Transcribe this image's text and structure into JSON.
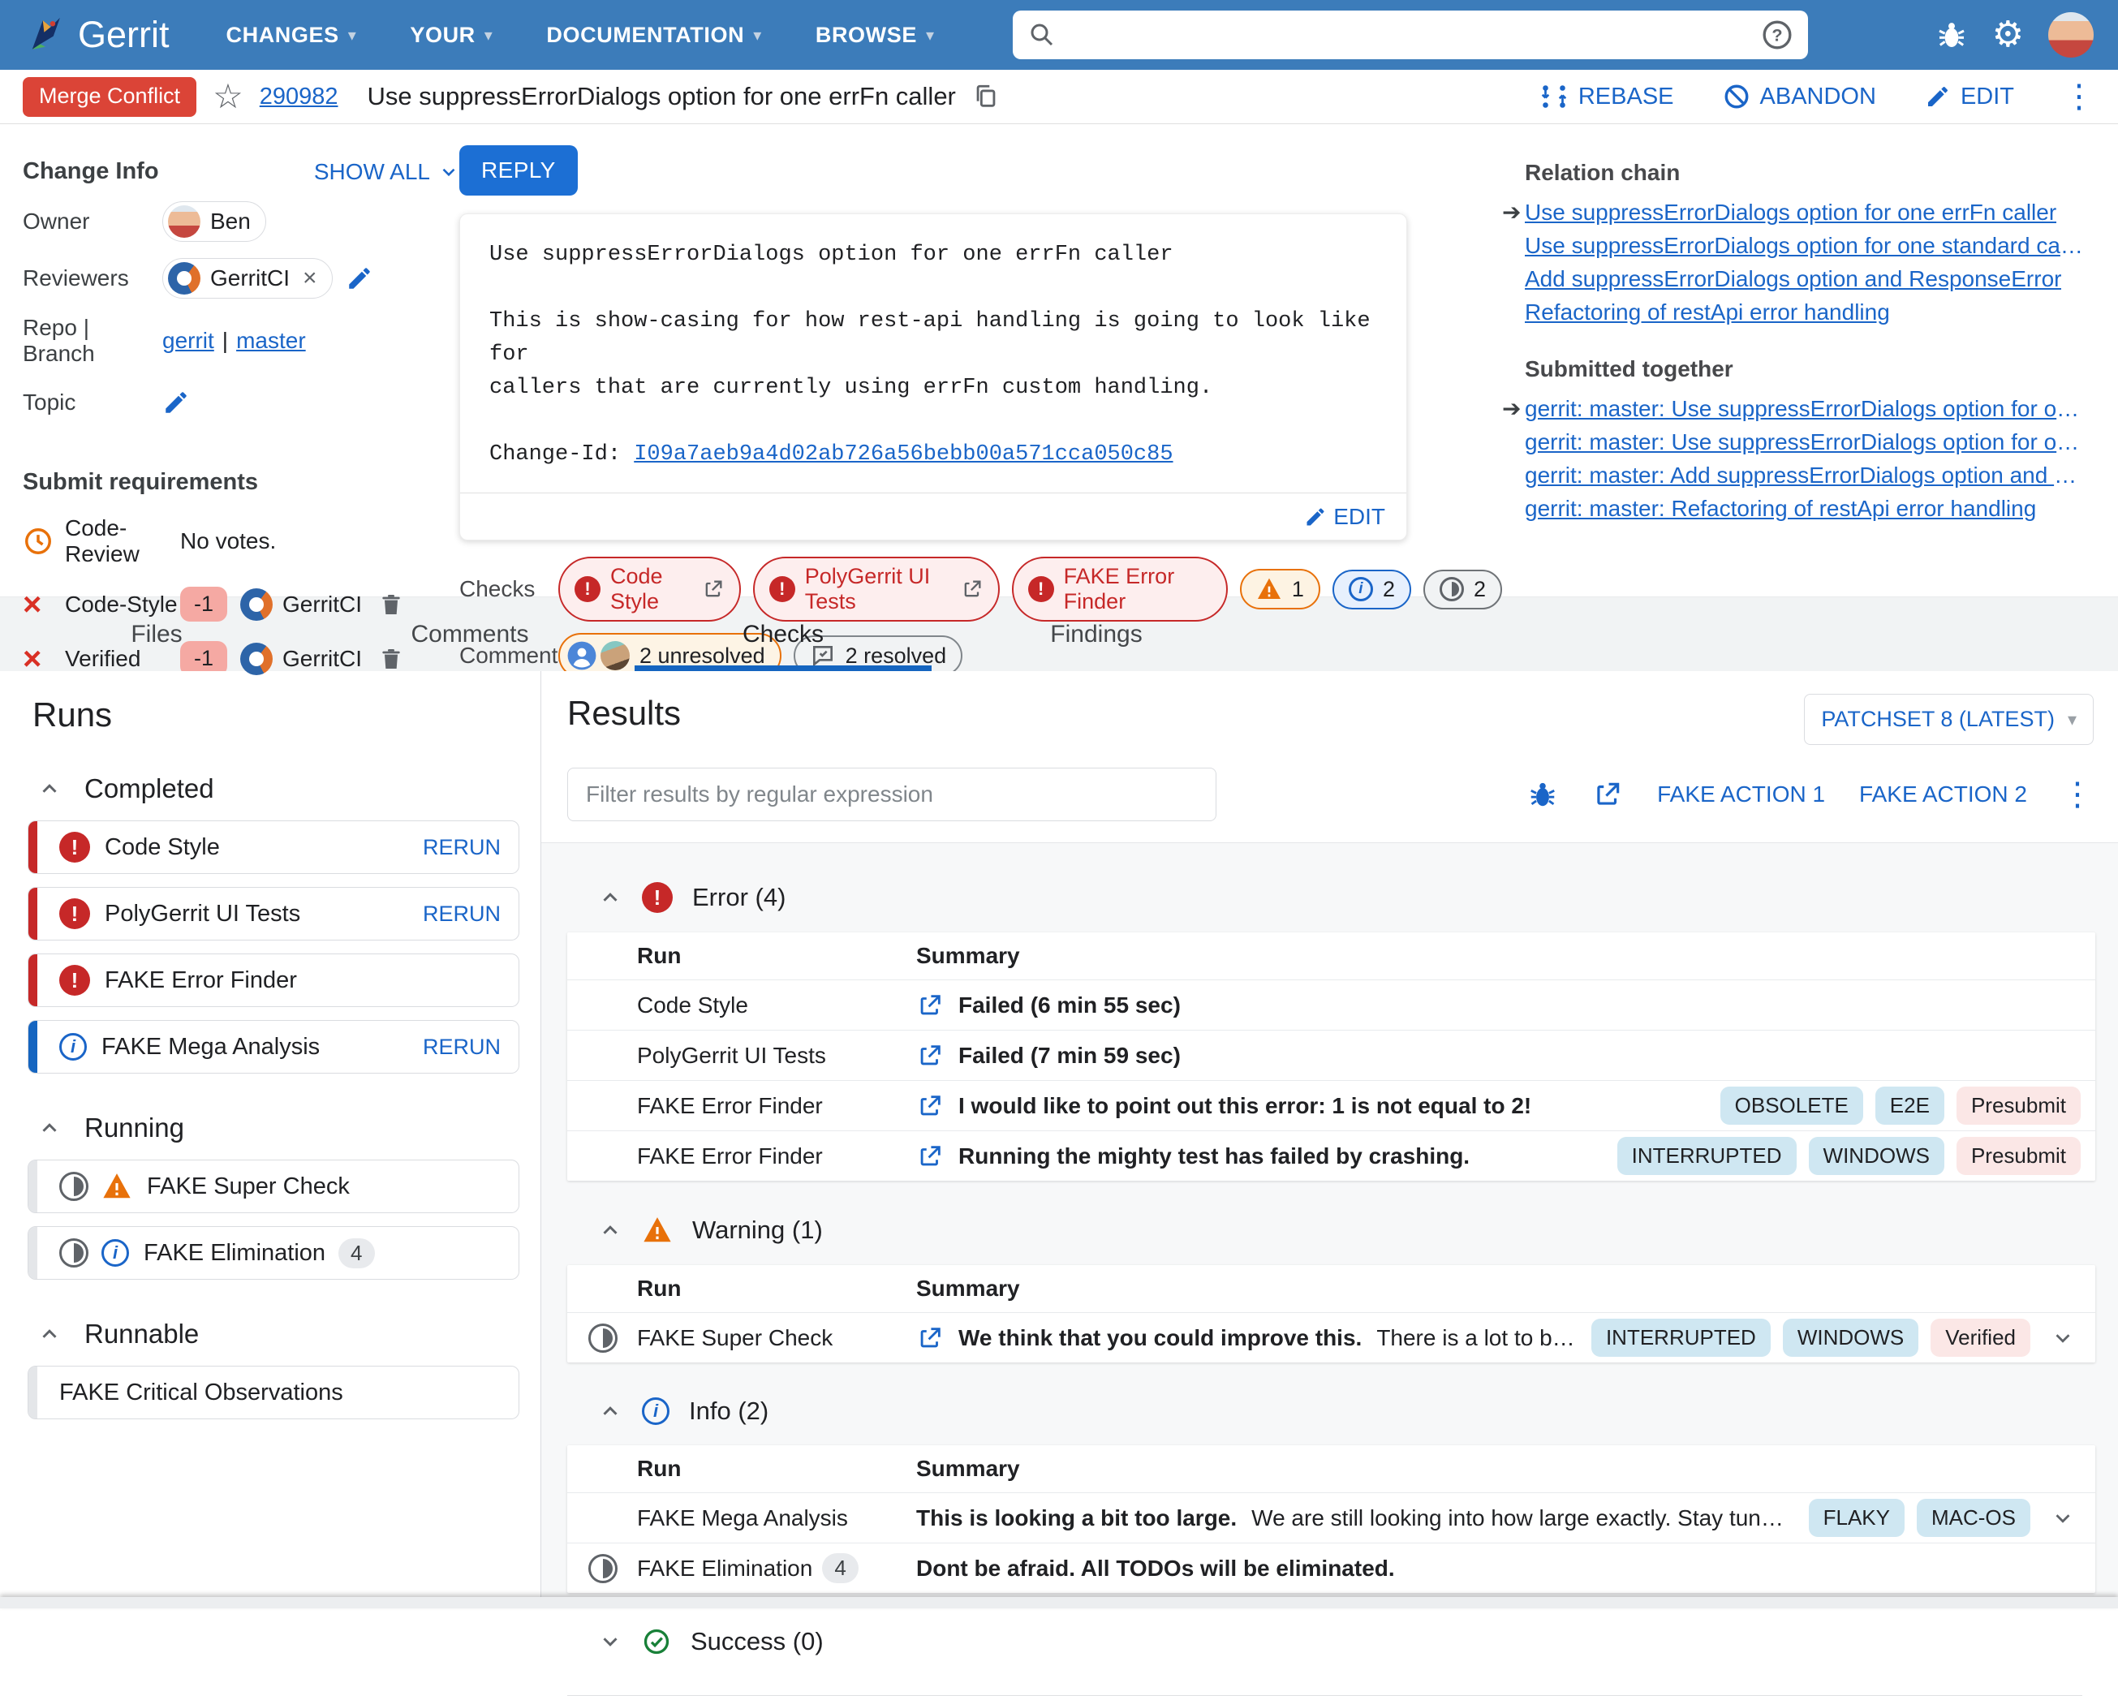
{
  "nav": {
    "brand": "Gerrit",
    "menus": [
      {
        "label": "CHANGES"
      },
      {
        "label": "YOUR"
      },
      {
        "label": "DOCUMENTATION"
      },
      {
        "label": "BROWSE"
      }
    ],
    "search_value": ""
  },
  "header": {
    "status": "Merge Conflict",
    "change_number": "290982",
    "title": "Use suppressErrorDialogs option for one errFn caller",
    "rebase": "REBASE",
    "abandon": "ABANDON",
    "edit": "EDIT"
  },
  "change_info": {
    "heading": "Change Info",
    "show_all": "SHOW ALL",
    "owner_label": "Owner",
    "owner": "Ben",
    "reviewers_label": "Reviewers",
    "reviewer": "GerritCI",
    "repo_branch_label": "Repo | Branch",
    "repo": "gerrit",
    "branch": "master",
    "topic_label": "Topic"
  },
  "reply": "REPLY",
  "commit": {
    "subject": "Use suppressErrorDialogs option for one errFn caller",
    "body1": "This is show-casing for how rest-api handling is going to look like for",
    "body2": "callers that are currently using errFn custom handling.",
    "change_id_label": "Change-Id:",
    "change_id": "I09a7aeb9a4d02ab726a56bebb00a571cca050c85",
    "edit": "EDIT"
  },
  "relation": {
    "heading": "Relation chain",
    "items": [
      {
        "label": "Use suppressErrorDialogs option for one errFn caller"
      },
      {
        "label": "Use suppressErrorDialogs option for one standard caller"
      },
      {
        "label": "Add suppressErrorDialogs option and ResponseError"
      },
      {
        "label": "Refactoring of restApi error handling"
      }
    ],
    "submitted_heading": "Submitted together",
    "submitted": [
      {
        "label": "gerrit: master: Use suppressErrorDialogs option for one ..."
      },
      {
        "label": "gerrit: master: Use suppressErrorDialogs option for one ..."
      },
      {
        "label": "gerrit: master: Add suppressErrorDialogs option and Res..."
      },
      {
        "label": "gerrit: master: Refactoring of restApi error handling"
      }
    ]
  },
  "submit_req": {
    "heading": "Submit requirements",
    "rows": [
      {
        "name": "Code-Review",
        "value": "No votes."
      },
      {
        "name": "Code-Style",
        "vote": "-1",
        "account": "GerritCI"
      },
      {
        "name": "Verified",
        "vote": "-1",
        "account": "GerritCI"
      }
    ]
  },
  "checks_line": {
    "label": "Checks",
    "chips": [
      {
        "label": "Code Style"
      },
      {
        "label": "PolyGerrit UI Tests"
      },
      {
        "label": "FAKE Error Finder"
      },
      {
        "count": "1"
      },
      {
        "count": "2"
      },
      {
        "count": "2"
      }
    ]
  },
  "comments_line": {
    "label": "Comments",
    "unresolved": "2 unresolved",
    "resolved": "2 resolved"
  },
  "tabs": [
    {
      "label": "Files"
    },
    {
      "label": "Comments"
    },
    {
      "label": "Checks"
    },
    {
      "label": "Findings"
    }
  ],
  "runs": {
    "heading": "Runs",
    "completed_title": "Completed",
    "completed": [
      {
        "name": "Code Style",
        "action": "RERUN"
      },
      {
        "name": "PolyGerrit UI Tests",
        "action": "RERUN"
      },
      {
        "name": "FAKE Error Finder"
      },
      {
        "name": "FAKE Mega Analysis",
        "action": "RERUN"
      }
    ],
    "running_title": "Running",
    "running": [
      {
        "name": "FAKE Super Check"
      },
      {
        "name": "FAKE Elimination",
        "badge": "4"
      }
    ],
    "runnable_title": "Runnable",
    "runnable": [
      {
        "name": "FAKE Critical Observations"
      }
    ]
  },
  "results": {
    "heading": "Results",
    "patchset": "PATCHSET 8 (LATEST)",
    "filter_placeholder": "Filter results by regular expression",
    "action1": "FAKE ACTION 1",
    "action2": "FAKE ACTION 2",
    "col_run": "Run",
    "col_summary": "Summary",
    "error": {
      "title": "Error (4)",
      "rows": [
        {
          "run": "Code Style",
          "summary": "Failed (6 min 55 sec)"
        },
        {
          "run": "PolyGerrit UI Tests",
          "summary": "Failed (7 min 59 sec)"
        },
        {
          "run": "FAKE Error Finder",
          "summary": "I would like to point out this error: 1 is not equal to 2!",
          "tags": [
            {
              "label": "OBSOLETE"
            },
            {
              "label": "E2E"
            },
            {
              "label": "Presubmit"
            }
          ]
        },
        {
          "run": "FAKE Error Finder",
          "summary": "Running the mighty test has failed by crashing.",
          "tags": [
            {
              "label": "INTERRUPTED"
            },
            {
              "label": "WINDOWS"
            },
            {
              "label": "Presubmit"
            }
          ]
        }
      ]
    },
    "warning": {
      "title": "Warning (1)",
      "rows": [
        {
          "run": "FAKE Super Check",
          "summary": "We think that you could improve this.",
          "summary_rest": "There is a lot to be said....",
          "tags": [
            {
              "label": "INTERRUPTED"
            },
            {
              "label": "WINDOWS"
            },
            {
              "label": "Verified"
            }
          ]
        }
      ]
    },
    "info": {
      "title": "Info (2)",
      "rows": [
        {
          "run": "FAKE Mega Analysis",
          "summary": "This is looking a bit too large.",
          "summary_rest": "We are still looking into how large exactly. Stay tuned. An...",
          "tags": [
            {
              "label": "FLAKY"
            },
            {
              "label": "MAC-OS"
            }
          ]
        },
        {
          "run": "FAKE Elimination",
          "badge": "4",
          "summary": "Dont be afraid. All TODOs will be eliminated."
        }
      ]
    },
    "success": {
      "title": "Success (0)"
    }
  },
  "colors": {
    "nav_blue": "#3c7cba",
    "link_blue": "#1a65c8",
    "error_red": "#c62828",
    "merge_conflict_red": "#db4437",
    "warning_orange": "#e8710a",
    "tag_cyan": "#cfe7f2",
    "tag_pink": "#fbe7e6",
    "results_bg": "#f7f8f9"
  }
}
